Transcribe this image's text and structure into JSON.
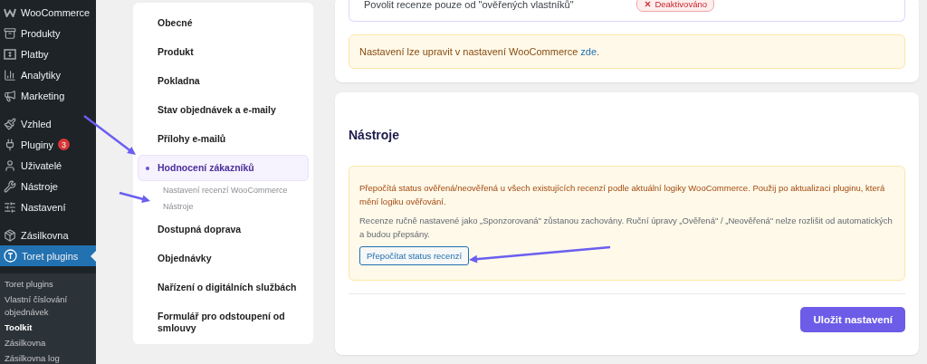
{
  "admin_menu": {
    "groups": [
      {
        "items": [
          {
            "label": "WooCommerce",
            "selected": false
          },
          {
            "label": "Produkty",
            "selected": false
          },
          {
            "label": "Platby",
            "selected": false
          },
          {
            "label": "Analytiky",
            "selected": false
          },
          {
            "label": "Marketing",
            "selected": false
          }
        ]
      },
      {
        "items": [
          {
            "label": "Vzhled",
            "selected": false
          },
          {
            "label": "Pluginy",
            "selected": false,
            "badge": "3"
          },
          {
            "label": "Uživatelé",
            "selected": false
          },
          {
            "label": "Nástroje",
            "selected": false
          },
          {
            "label": "Nastavení",
            "selected": false
          }
        ]
      },
      {
        "items": [
          {
            "label": "Zásilkovna",
            "selected": false
          },
          {
            "label": "Toret plugins",
            "selected": true
          }
        ]
      }
    ],
    "submenu": [
      {
        "label": "Toret plugins",
        "selected": false
      },
      {
        "label": "Vlastní číslování objednávek",
        "selected": false
      },
      {
        "label": "Toolkit",
        "selected": true
      },
      {
        "label": "Zásilkovna",
        "selected": false
      },
      {
        "label": "Zásilkovna log",
        "selected": false
      }
    ]
  },
  "settings_nav": {
    "items": [
      {
        "label": "Obecné",
        "selected": false
      },
      {
        "label": "Produkt",
        "selected": false
      },
      {
        "label": "Pokladna",
        "selected": false
      },
      {
        "label": "Stav objednávek a e-maily",
        "selected": false
      },
      {
        "label": "Přílohy e-mailů",
        "selected": false
      },
      {
        "label": "Hodnocení zákazníků",
        "selected": true,
        "children": [
          {
            "label": "Nastavení recenzí WooCommerce",
            "selected": false
          },
          {
            "label": "Nástroje",
            "selected": false
          }
        ]
      },
      {
        "label": "Dostupná doprava",
        "selected": false
      },
      {
        "label": "Objednávky",
        "selected": false
      },
      {
        "label": "Nařízení o digitálních službách",
        "selected": false
      },
      {
        "label": "Formulář pro odstoupení od smlouvy",
        "selected": false
      }
    ]
  },
  "reviews_card": {
    "setting": {
      "label": "Povolit recenze pouze od \"ověřených vlastníků\"",
      "status": "Deaktivováno",
      "enabled": false
    },
    "notice": {
      "text": "Nastavení lze upravit v nastavení WooCommerce",
      "link": "zde",
      "after": "."
    }
  },
  "tools_card": {
    "title": "Nástroje",
    "notice": {
      "warning": "Přepočítá status ověřená/neověřená u všech existujících recenzí podle aktuální logiky WooCommerce. Použij po aktualizaci pluginu, která mění logiku ověřování.",
      "note": "Recenze ručně nastavené jako „Sponzorovaná\" zůstanou zachovány. Ruční úpravy „Ověřená\" / „Neověřená\" nelze rozlišit od automatických a budou přepsány.",
      "button": "Přepočítat status recenzí"
    },
    "save_button": "Uložit nastavení"
  }
}
